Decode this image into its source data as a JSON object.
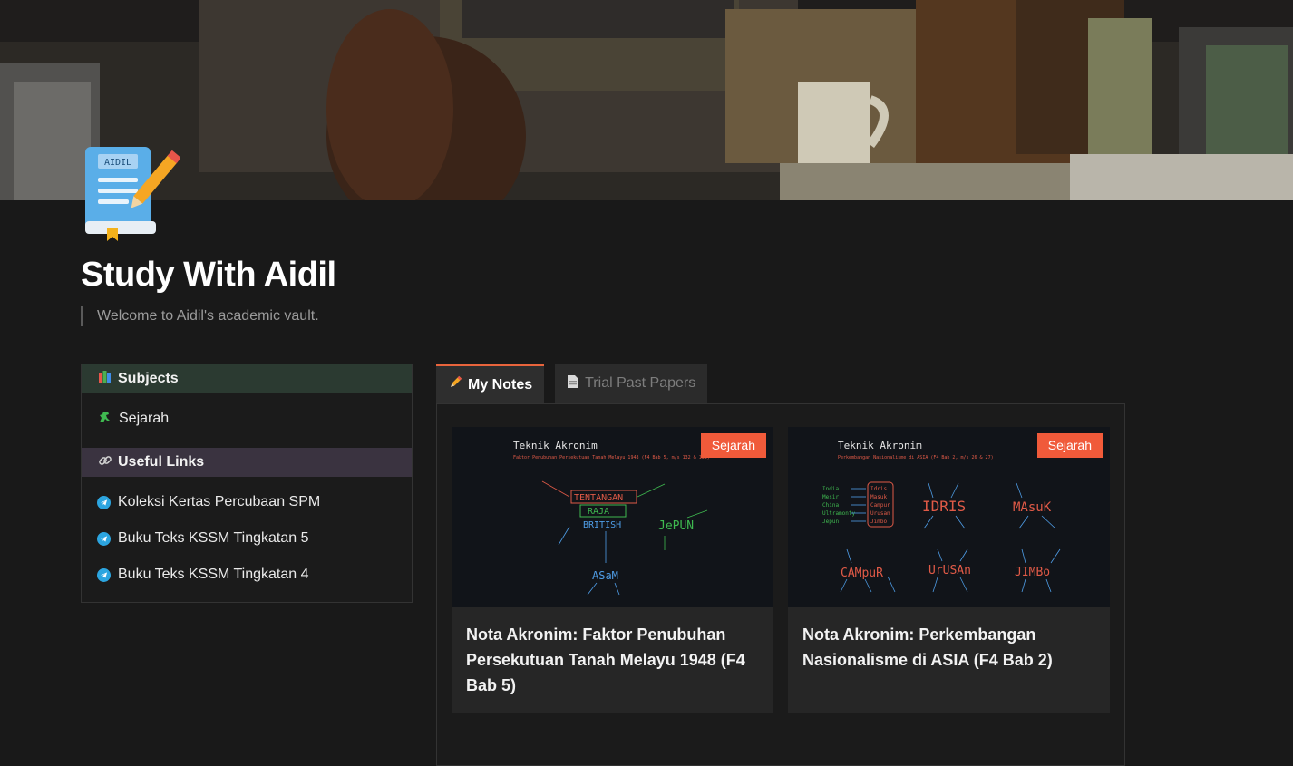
{
  "page": {
    "title": "Study With Aidil",
    "quote": "Welcome to Aidil's academic vault.",
    "icon_name": "notebook-pencil-icon",
    "icon_label": "AIDIL"
  },
  "sidebar": {
    "subjects_header": {
      "icon": "books-icon",
      "label": "Subjects"
    },
    "subjects": [
      {
        "icon": "dinosaur-icon",
        "label": "Sejarah"
      }
    ],
    "links_header": {
      "icon": "link-icon",
      "label": "Useful Links"
    },
    "links": [
      {
        "icon": "telegram-icon",
        "label": "Koleksi Kertas Percubaan SPM"
      },
      {
        "icon": "telegram-icon",
        "label": "Buku Teks KSSM Tingkatan 5"
      },
      {
        "icon": "telegram-icon",
        "label": "Buku Teks KSSM Tingkatan 4"
      }
    ]
  },
  "tabs": [
    {
      "icon": "pencil-icon",
      "label": "My Notes",
      "active": true
    },
    {
      "icon": "document-icon",
      "label": "Trial Past Papers",
      "active": false
    }
  ],
  "cards": [
    {
      "badge": "Sejarah",
      "title": "Nota Akronim: Faktor Penubuhan Persekutuan Tanah Melayu 1948 (F4 Bab 5)",
      "thumb": {
        "heading": "Teknik Akronim",
        "subheading": "Faktor Penubuhan Persekutuan Tanah Melayu 1948 (F4 Bab 5, m/s 132 & 133)",
        "words": [
          "TENTANGAN",
          "RAJA",
          "BRITISH",
          "JePUN",
          "ASaM"
        ]
      }
    },
    {
      "badge": "Sejarah",
      "title": "Nota Akronim: Perkembangan Nasionalisme di ASIA (F4 Bab 2)",
      "thumb": {
        "heading": "Teknik Akronim",
        "subheading": "Perkembangan Nasionalisme di ASIA (F4 Bab 2, m/s 26 & 27)",
        "words": [
          "IDRIS",
          "MAsuK",
          "CAMpuR",
          "UrUSAn",
          "JIMBo"
        ],
        "box_words": [
          "India",
          "Mesir",
          "China",
          "Ultramonty",
          "Jepun"
        ],
        "box_acronym": [
          "Idris",
          "Masuk",
          "Campur",
          "Urusan",
          "Jimbo"
        ]
      }
    }
  ],
  "colors": {
    "background": "#191919",
    "accent": "#f05a3a",
    "telegram": "#2ca5e0",
    "subjects_header_bg": "#2b3a31",
    "links_header_bg": "#3a3340"
  }
}
